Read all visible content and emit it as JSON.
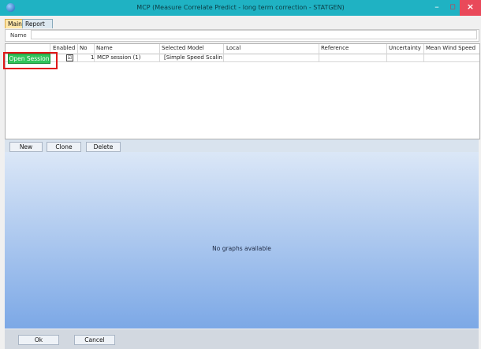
{
  "window": {
    "title": "MCP (Measure Correlate Predict - long term correction - STATGEN)",
    "minimize_glyph": "–",
    "maximize_glyph": "◻",
    "close_glyph": "×",
    "colors": {
      "titlebar": "#1fb2c3",
      "close": "#e9495a"
    }
  },
  "tabs": [
    {
      "label": "Main",
      "active": true
    },
    {
      "label": "Report Headers",
      "active": false
    }
  ],
  "name_field": {
    "label": "Name",
    "value": ""
  },
  "grid": {
    "columns": [
      "Enabled",
      "No",
      "Name",
      "Selected Model",
      "Local",
      "Reference",
      "Uncertainty",
      "Mean Wind Speed"
    ],
    "rows": [
      {
        "action": "Open Session",
        "enabled": "☑",
        "no": "1",
        "name": "MCP session (1)",
        "selected_model": "[Simple Speed Scaling]",
        "local": "",
        "reference": "",
        "uncertainty": "",
        "mean_wind_speed": ""
      }
    ]
  },
  "toolbar": {
    "new": "New",
    "clone": "Clone",
    "delete": "Delete"
  },
  "graph_area": {
    "message": "No graphs available"
  },
  "footer": {
    "ok": "Ok",
    "cancel": "Cancel"
  }
}
